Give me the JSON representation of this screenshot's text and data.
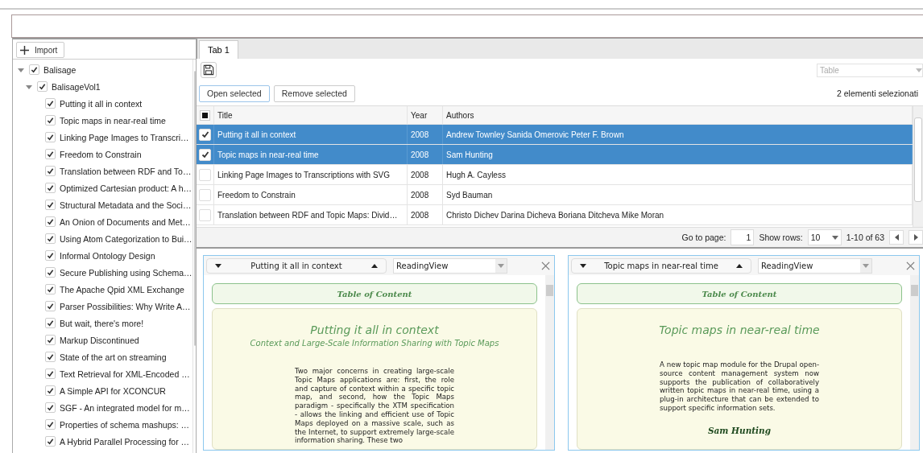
{
  "import_button": "Import",
  "tree": [
    {
      "label": "Balisage",
      "checked": true,
      "expanded": true,
      "children": [
        {
          "label": "BalisageVol1",
          "checked": true,
          "expanded": true,
          "children": [
            {
              "label": "Putting it all in context",
              "checked": true
            },
            {
              "label": "Topic maps in near-real time",
              "checked": true
            },
            {
              "label": "Linking Page Images to Transcri…",
              "checked": true
            },
            {
              "label": "Freedom to Constrain",
              "checked": true
            },
            {
              "label": "Translation between RDF and To…",
              "checked": true
            },
            {
              "label": "Optimized Cartesian product: A h…",
              "checked": true
            },
            {
              "label": "Structural Metadata and the Soci…",
              "checked": true
            },
            {
              "label": "An Onion of Documents and Met…",
              "checked": true
            },
            {
              "label": "Using Atom Categorization to Bui…",
              "checked": true
            },
            {
              "label": "Informal Ontology Design",
              "checked": true
            },
            {
              "label": "Secure Publishing using Schema…",
              "checked": true
            },
            {
              "label": "The Apache Qpid XML Exchange",
              "checked": true
            },
            {
              "label": "Parser Possibilities: Why Write A…",
              "checked": true
            },
            {
              "label": "But wait, there's more!",
              "checked": true
            },
            {
              "label": "Markup Discontinued",
              "checked": true
            },
            {
              "label": "State of the art on streaming",
              "checked": true
            },
            {
              "label": "Text Retrieval for XML-Encoded …",
              "checked": true
            },
            {
              "label": "A Simple API for XCONCUR",
              "checked": true
            },
            {
              "label": "SGF - An integrated model for m…",
              "checked": true
            },
            {
              "label": "Properties of schema mashups: …",
              "checked": true
            },
            {
              "label": "A Hybrid Parallel Processing for …",
              "checked": true
            }
          ]
        }
      ]
    }
  ],
  "tabs": [
    {
      "label": "Tab 1",
      "selected": true
    }
  ],
  "view_select": {
    "placeholder": "Table"
  },
  "buttons": [
    "Open selected",
    "Remove selected"
  ],
  "selection_count": "2 elementi selezionati",
  "table": {
    "all_checked_partial": true,
    "columns": [
      "Title",
      "Year",
      "Authors"
    ],
    "rows": [
      {
        "selected": true,
        "cells": [
          "Putting it all in context",
          "2008",
          "Andrew Townley Sanida Omerovic Peter F. Brown"
        ]
      },
      {
        "selected": true,
        "cells": [
          "Topic maps in near-real time",
          "2008",
          "Sam Hunting"
        ]
      },
      {
        "selected": false,
        "cells": [
          "Linking Page Images to Transcriptions with SVG",
          "2008",
          "Hugh A. Cayless"
        ]
      },
      {
        "selected": false,
        "cells": [
          "Freedom to Constrain",
          "2008",
          "Syd Bauman"
        ]
      },
      {
        "selected": false,
        "cells": [
          "Translation between RDF and Topic Maps: Divid…",
          "2008",
          "Christo Dichev Darina Dicheva Boriana Ditcheva Mike Moran"
        ]
      }
    ]
  },
  "pager": {
    "goto_label": "Go to page:",
    "page": "1",
    "rows_label": "Show rows:",
    "rows": "10",
    "range": "1-10 of 63"
  },
  "readers": [
    {
      "title": "Putting it all in context",
      "view": "ReadingView",
      "toc": "Table of Content",
      "doc_title": "Putting it all in context",
      "subtitle": "Context and Large-Scale Information Sharing with Topic Maps",
      "abstract": "Two major concerns in creating large-scale Topic Maps applications are: first, the role and capture of context within a specific topic map, and second, how the Topic Maps paradigm - specifically the XTM specification - allows the linking and efficient use of Topic Maps deployed on a massive scale, such as the Internet, to support extremely large-scale information sharing. These two"
    },
    {
      "title": "Topic maps in near-real time",
      "view": "ReadingView",
      "toc": "Table of Content",
      "doc_title": "Topic maps in near-real time",
      "abstract": "A new topic map module for the Drupal open-source content management system now supports the publication of collaboratively written topic maps in near-real time, using a plug-in architecture that can be extended to support specific information sets.",
      "author": "Sam Hunting"
    }
  ]
}
